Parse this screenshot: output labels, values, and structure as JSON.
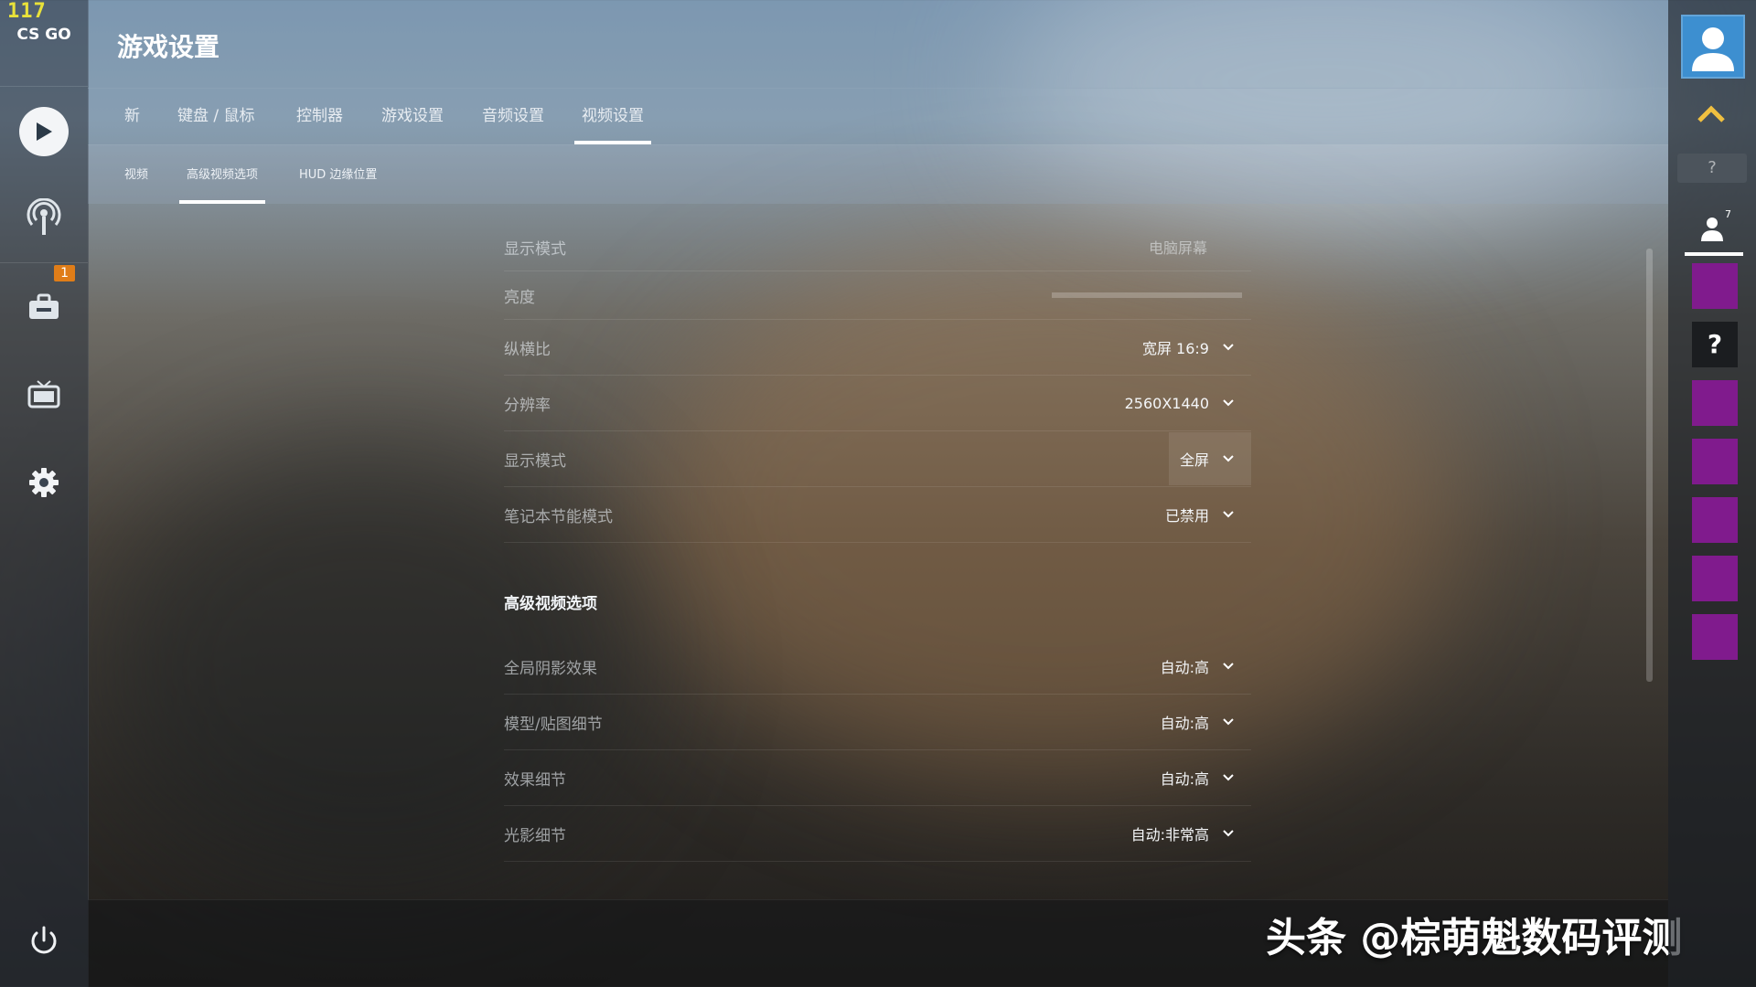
{
  "fps": "117",
  "app": {
    "logo_text": "CS GO"
  },
  "header": {
    "title": "游戏设置"
  },
  "tabs": [
    {
      "label": "新"
    },
    {
      "label": "键盘 / 鼠标"
    },
    {
      "label": "控制器"
    },
    {
      "label": "游戏设置"
    },
    {
      "label": "音频设置"
    },
    {
      "label": "视频设置",
      "active": true
    }
  ],
  "subtabs": [
    {
      "label": "视频"
    },
    {
      "label": "高级视频选项",
      "active": true
    },
    {
      "label": "HUD 边缘位置"
    }
  ],
  "left_rail": {
    "inventory_badge": "1",
    "icons": [
      "play-icon",
      "broadcast-icon",
      "inventory-icon",
      "tv-icon",
      "gear-icon",
      "power-icon"
    ]
  },
  "settings": {
    "basic": [
      {
        "label": "显示模式",
        "value": "电脑屏幕",
        "type": "readonly"
      },
      {
        "label": "亮度",
        "value": "",
        "type": "slider",
        "slider_fraction": 0.0
      },
      {
        "label": "纵横比",
        "value": "宽屏 16:9",
        "type": "dropdown"
      },
      {
        "label": "分辨率",
        "value": "2560X1440",
        "type": "dropdown"
      },
      {
        "label": "显示模式",
        "value": "全屏",
        "type": "dropdown",
        "highlighted": true
      },
      {
        "label": "笔记本节能模式",
        "value": "已禁用",
        "type": "dropdown"
      }
    ],
    "advanced_title": "高级视频选项",
    "advanced": [
      {
        "label": "全局阴影效果",
        "value": "自动:高"
      },
      {
        "label": "模型/贴图细节",
        "value": "自动:高"
      },
      {
        "label": "效果细节",
        "value": "自动:高"
      },
      {
        "label": "光影细节",
        "value": "自动:非常高"
      }
    ]
  },
  "right_rail": {
    "help_small": "?",
    "friend_count": "7",
    "help_tile": "?",
    "friend_tile_color": "#801b8d"
  },
  "watermark": "头条 @棕萌魁数码评测",
  "colors": {
    "accent": "#ffffff",
    "badge": "#e07d18",
    "friend_tile": "#801b8d"
  }
}
